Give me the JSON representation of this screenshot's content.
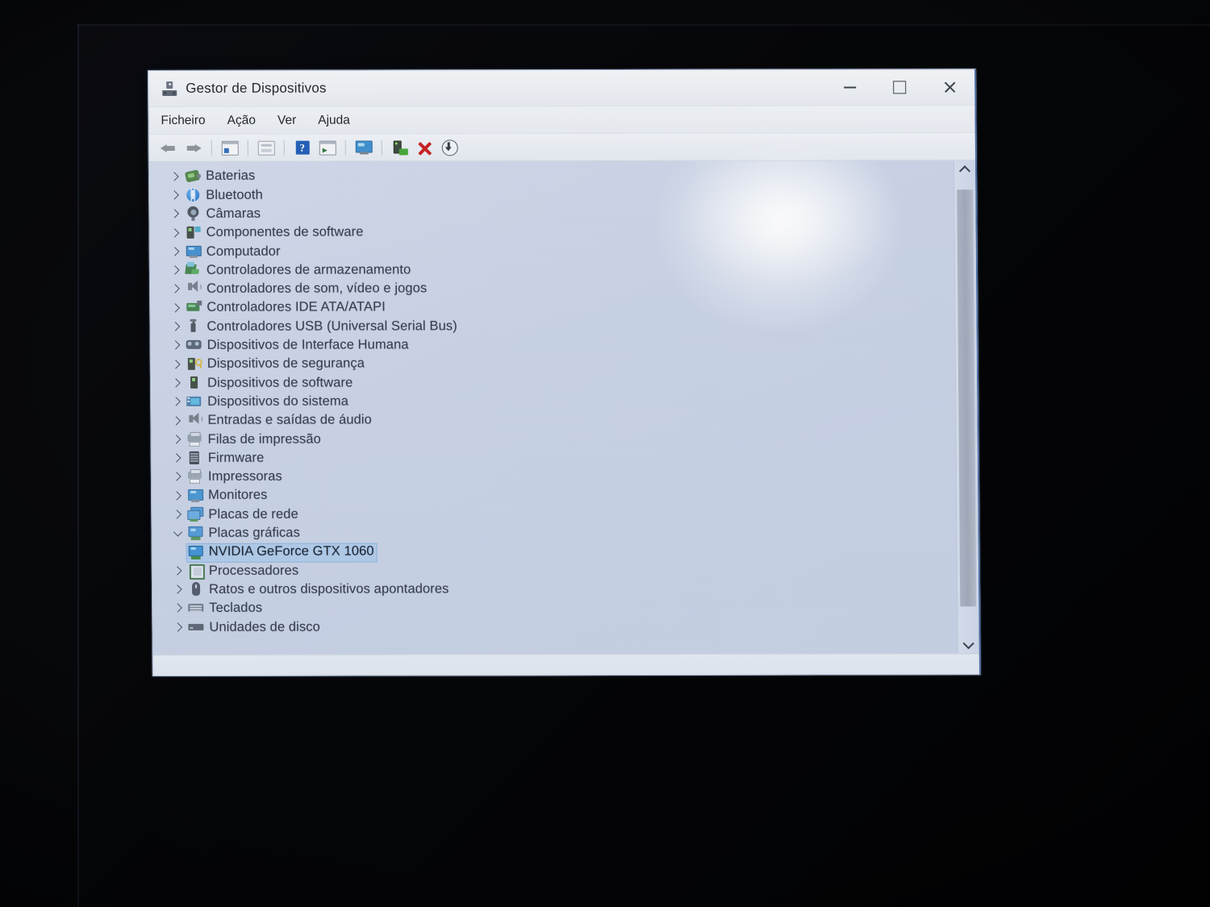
{
  "window": {
    "title": "Gestor de Dispositivos",
    "title_icon": "device-manager-icon",
    "controls": {
      "minimize": "–",
      "maximize": "□",
      "close": "✕"
    }
  },
  "menubar": {
    "items": [
      {
        "label": "Ficheiro"
      },
      {
        "label": "Ação"
      },
      {
        "label": "Ver"
      },
      {
        "label": "Ajuda"
      }
    ]
  },
  "toolbar": {
    "buttons": [
      {
        "icon": "back-arrow-icon"
      },
      {
        "icon": "forward-arrow-icon"
      },
      {
        "icon": "properties-icon"
      },
      {
        "icon": "save-list-icon"
      },
      {
        "icon": "help-icon",
        "label": "?"
      },
      {
        "icon": "scan-hardware-changes-icon"
      },
      {
        "icon": "display-devices-icon"
      },
      {
        "icon": "update-driver-icon"
      },
      {
        "icon": "uninstall-device-icon"
      },
      {
        "icon": "download-driver-icon"
      }
    ]
  },
  "tree": {
    "items": [
      {
        "label": "Baterias",
        "icon": "battery-icon",
        "expanded": false,
        "level": 0
      },
      {
        "label": "Bluetooth",
        "icon": "bluetooth-icon",
        "expanded": false,
        "level": 0
      },
      {
        "label": "Câmaras",
        "icon": "camera-icon",
        "expanded": false,
        "level": 0
      },
      {
        "label": "Componentes de software",
        "icon": "software-component-icon",
        "expanded": false,
        "level": 0
      },
      {
        "label": "Computador",
        "icon": "computer-icon",
        "expanded": false,
        "level": 0
      },
      {
        "label": "Controladores de armazenamento",
        "icon": "storage-controller-icon",
        "expanded": false,
        "level": 0
      },
      {
        "label": "Controladores de som, vídeo e jogos",
        "icon": "sound-controller-icon",
        "expanded": false,
        "level": 0
      },
      {
        "label": "Controladores IDE ATA/ATAPI",
        "icon": "ide-controller-icon",
        "expanded": false,
        "level": 0
      },
      {
        "label": "Controladores USB (Universal Serial Bus)",
        "icon": "usb-controller-icon",
        "expanded": false,
        "level": 0
      },
      {
        "label": "Dispositivos de Interface Humana",
        "icon": "hid-icon",
        "expanded": false,
        "level": 0
      },
      {
        "label": "Dispositivos de segurança",
        "icon": "security-device-icon",
        "expanded": false,
        "level": 0
      },
      {
        "label": "Dispositivos de software",
        "icon": "software-device-icon",
        "expanded": false,
        "level": 0
      },
      {
        "label": "Dispositivos do sistema",
        "icon": "system-device-icon",
        "expanded": false,
        "level": 0
      },
      {
        "label": "Entradas e saídas de áudio",
        "icon": "audio-io-icon",
        "expanded": false,
        "level": 0
      },
      {
        "label": "Filas de impressão",
        "icon": "print-queue-icon",
        "expanded": false,
        "level": 0
      },
      {
        "label": "Firmware",
        "icon": "firmware-icon",
        "expanded": false,
        "level": 0
      },
      {
        "label": "Impressoras",
        "icon": "printer-icon",
        "expanded": false,
        "level": 0
      },
      {
        "label": "Monitores",
        "icon": "monitor-icon",
        "expanded": false,
        "level": 0
      },
      {
        "label": "Placas de rede",
        "icon": "network-adapter-icon",
        "expanded": false,
        "level": 0
      },
      {
        "label": "Placas gráficas",
        "icon": "display-adapter-icon",
        "expanded": true,
        "level": 0
      },
      {
        "label": "NVIDIA GeForce GTX 1060",
        "icon": "display-adapter-icon",
        "expanded": null,
        "level": 1,
        "selected": true
      },
      {
        "label": "Processadores",
        "icon": "processor-icon",
        "expanded": false,
        "level": 0
      },
      {
        "label": "Ratos e outros dispositivos apontadores",
        "icon": "mouse-icon",
        "expanded": false,
        "level": 0
      },
      {
        "label": "Teclados",
        "icon": "keyboard-icon",
        "expanded": false,
        "level": 0
      },
      {
        "label": "Unidades de disco",
        "icon": "disk-drive-icon",
        "expanded": false,
        "level": 0
      }
    ]
  },
  "scrollbar": {
    "up_icon": "chevron-up-icon",
    "down_icon": "chevron-down-icon"
  },
  "statusbar": {
    "text": ""
  },
  "colors": {
    "selection": "#96c3f0",
    "content_bg": "#c7d2e8",
    "chrome_bg": "#e9ecf2",
    "text": "#1a2230",
    "accent_blue": "#1d5fbf",
    "danger_red": "#d11f1f",
    "ok_green": "#3ea832"
  }
}
